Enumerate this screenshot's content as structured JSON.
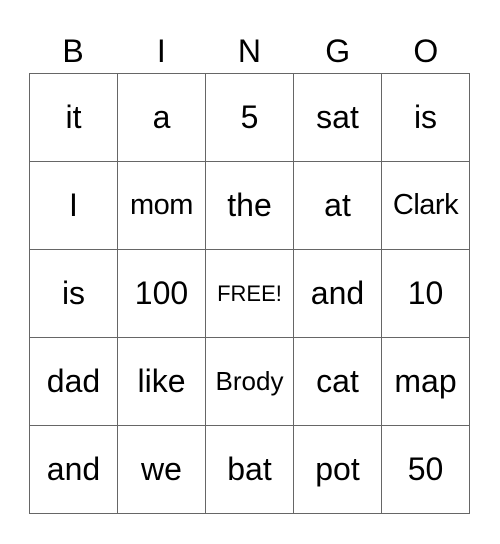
{
  "header": [
    "B",
    "I",
    "N",
    "G",
    "O"
  ],
  "rows": [
    [
      "it",
      "a",
      "5",
      "sat",
      "is"
    ],
    [
      "I",
      "mom",
      "the",
      "at",
      "Clark"
    ],
    [
      "is",
      "100",
      "FREE!",
      "and",
      "10"
    ],
    [
      "dad",
      "like",
      "Brody",
      "cat",
      "map"
    ],
    [
      "and",
      "we",
      "bat",
      "pot",
      "50"
    ]
  ]
}
